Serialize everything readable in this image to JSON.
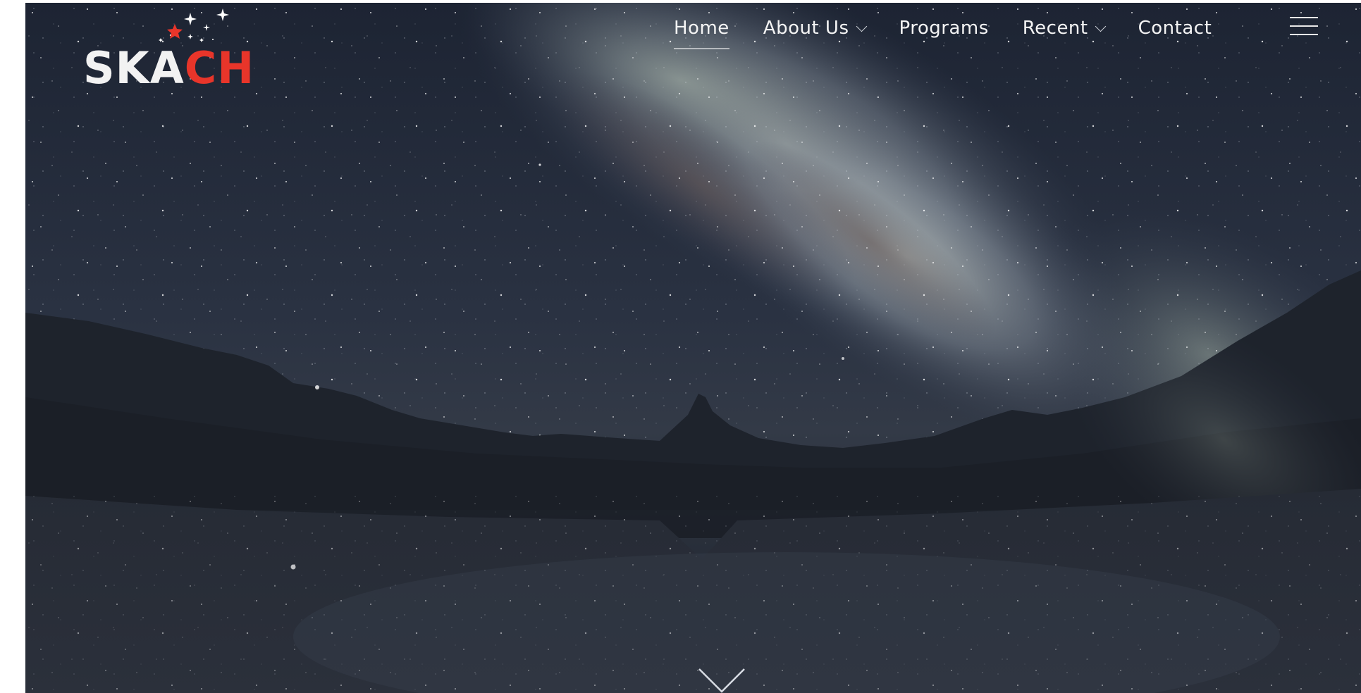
{
  "logo": {
    "text_white": "SKA",
    "text_red": "CH",
    "alt": "SKACH",
    "colors": {
      "white": "#f2f2f2",
      "red": "#e8352a"
    }
  },
  "nav": {
    "items": [
      {
        "label": "Home",
        "active": true,
        "has_dropdown": false
      },
      {
        "label": "About Us",
        "active": false,
        "has_dropdown": true
      },
      {
        "label": "Programs",
        "active": false,
        "has_dropdown": false
      },
      {
        "label": "Recent",
        "active": false,
        "has_dropdown": true
      },
      {
        "label": "Contact",
        "active": false,
        "has_dropdown": false
      }
    ],
    "menu_icon": "hamburger-menu-icon"
  },
  "hero": {
    "background": "milky-way-over-mountain-lake-photo",
    "scroll_icon": "chevron-down-icon"
  }
}
